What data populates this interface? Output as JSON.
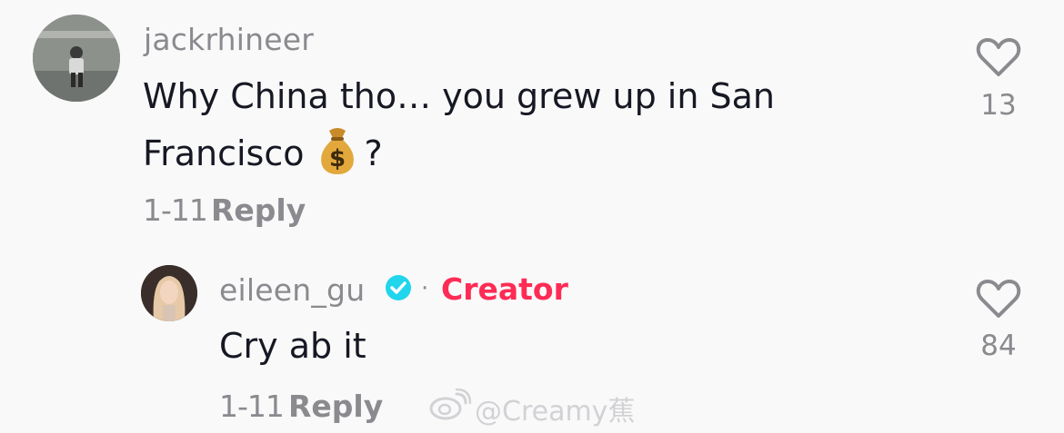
{
  "comments": [
    {
      "username": "jackrhineer",
      "text_line1": "Why China tho… you grew up in San",
      "text_line2_prefix": "Francisco",
      "text_line2_suffix": "?",
      "emoji": "money-bag-icon",
      "date": "1-11",
      "reply_label": "Reply",
      "likes": "13"
    },
    {
      "username": "eileen_gu",
      "badge_separator": "·",
      "creator_label": "Creator",
      "text": "Cry ab it",
      "date": "1-11",
      "reply_label": "Reply",
      "likes": "84"
    }
  ],
  "watermark": {
    "text": "@Creamy蕉"
  },
  "colors": {
    "creator": "#fe2c55",
    "verified": "#20d5ec",
    "muted": "#8a8a8f",
    "text": "#161823"
  }
}
